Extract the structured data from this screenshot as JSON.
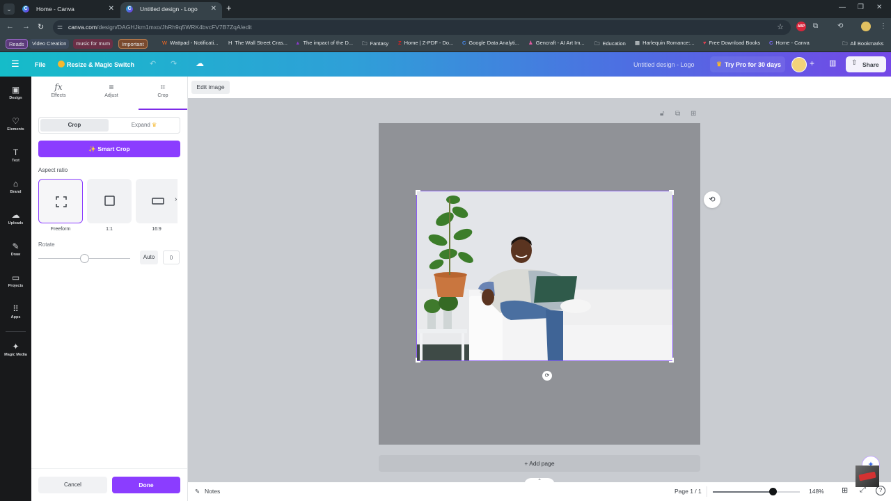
{
  "browser": {
    "tabs": [
      {
        "title": "Home - Canva",
        "active": false
      },
      {
        "title": "Untitled design - Logo",
        "active": true
      }
    ],
    "url_host": "canva.com",
    "url_path": "/design/DAGHJkm1mxo/JhRh9q5WRK4bvcFV7B7ZqA/edit",
    "bookmark_chips": [
      {
        "label": "Reads",
        "color": "#5b3a7a"
      },
      {
        "label": "Video Creation",
        "color": "#3d4a5c"
      },
      {
        "label": "music for mum",
        "color": "#6a2f46"
      },
      {
        "label": "Important",
        "color": "#7a4a2e"
      }
    ],
    "bookmarks": [
      {
        "icon": "W",
        "label": "Wattpad - Notificati..."
      },
      {
        "icon": "H",
        "label": "The Wall Street Cras..."
      },
      {
        "icon": "▲",
        "label": "The impact of the D..."
      },
      {
        "icon": "🗀",
        "label": "Fantasy"
      },
      {
        "icon": "Z",
        "label": "Home | Z-PDF - Do..."
      },
      {
        "icon": "C",
        "label": "Google Data Analyti..."
      },
      {
        "icon": "♟",
        "label": "Gencraft - AI Art Im..."
      },
      {
        "icon": "🗀",
        "label": "Education"
      },
      {
        "icon": "▦",
        "label": "Harlequin Romance:..."
      },
      {
        "icon": "♥",
        "label": "Free Download Books"
      },
      {
        "icon": "C",
        "label": "Home - Canva"
      }
    ],
    "all_bookmarks": "All Bookmarks",
    "ext_badge": "ABP"
  },
  "canva_header": {
    "menu_icon": "☰",
    "file": "File",
    "resize": "Resize & Magic Switch",
    "design_title": "Untitled design - Logo",
    "try_pro": "Try Pro for 30 days",
    "share": "Share"
  },
  "rail": [
    {
      "icon": "▣",
      "label": "Design"
    },
    {
      "icon": "♡",
      "label": "Elements"
    },
    {
      "icon": "T",
      "label": "Text"
    },
    {
      "icon": "⌂",
      "label": "Brand"
    },
    {
      "icon": "☁",
      "label": "Uploads"
    },
    {
      "icon": "✎",
      "label": "Draw"
    },
    {
      "icon": "▭",
      "label": "Projects"
    },
    {
      "icon": "⠿",
      "label": "Apps"
    },
    {
      "icon": "✦",
      "label": "Magic Media"
    }
  ],
  "panel": {
    "tabs": [
      {
        "icon": "fx",
        "label": "Effects"
      },
      {
        "icon": "≡",
        "label": "Adjust"
      },
      {
        "icon": "⌗",
        "label": "Crop",
        "active": true
      }
    ],
    "segment": {
      "crop": "Crop",
      "expand": "Expand"
    },
    "smart_crop": "Smart Crop",
    "aspect_ratio_label": "Aspect ratio",
    "aspect_ratios": [
      {
        "label": "Freeform",
        "selected": true
      },
      {
        "label": "1:1",
        "selected": false
      },
      {
        "label": "16:9",
        "selected": false
      }
    ],
    "rotate_label": "Rotate",
    "rotate_slider_fraction": 0.5,
    "auto": "Auto",
    "rotate_value": "0",
    "cancel": "Cancel",
    "done": "Done"
  },
  "workspace": {
    "edit_image": "Edit image",
    "add_page": "+ Add page",
    "image_description": "Smiling man sitting on a white sofa with a laptop, potted plants on the left"
  },
  "footer": {
    "notes": "Notes",
    "page": "Page 1 / 1",
    "zoom": "148%",
    "zoom_slider_fraction": 0.69
  },
  "colors": {
    "accent": "#8b3dff",
    "page_bg": "#909297",
    "workspace_bg": "#c9ccd1"
  }
}
